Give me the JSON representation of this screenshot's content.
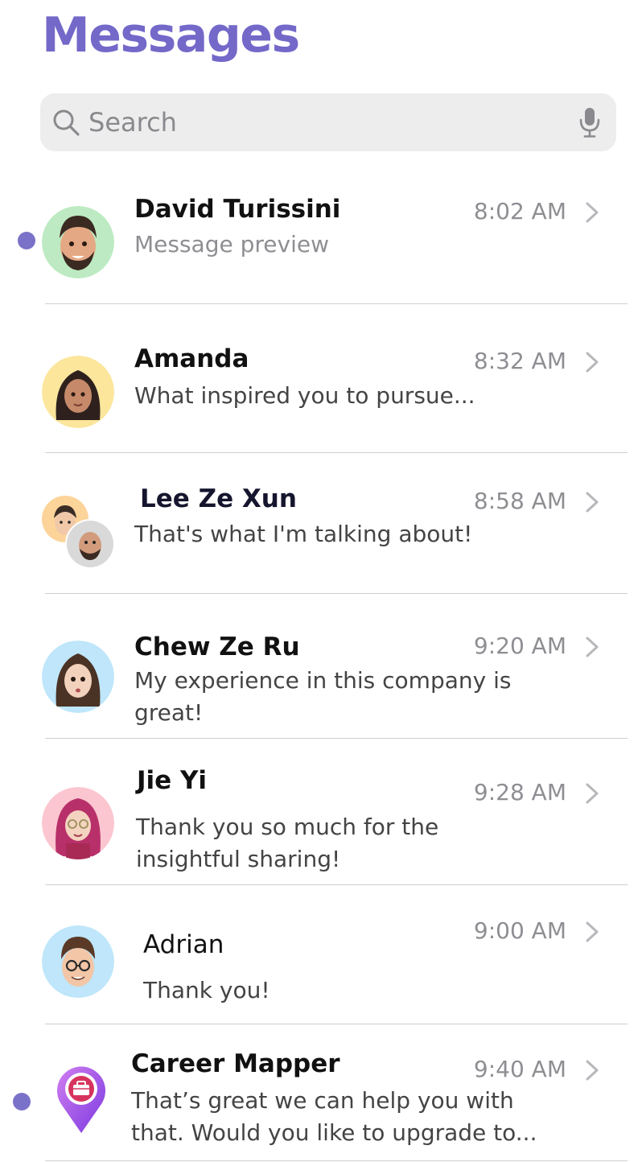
{
  "header": {
    "title": "Messages"
  },
  "search": {
    "placeholder": "Search",
    "search_icon": "magnifying-glass",
    "mic_icon": "microphone"
  },
  "accent_color": "#7468c9",
  "conversations": [
    {
      "name": "David Turissini",
      "preview": "Message preview",
      "time": "8:02 AM",
      "unread": true,
      "avatar": "memoji-man-beard-green"
    },
    {
      "name": "Amanda",
      "preview": "What inspired you to pursue...",
      "time": "8:32 AM",
      "unread": false,
      "avatar": "memoji-woman-yellow"
    },
    {
      "name": "Lee Ze Xun",
      "preview": "That's what I'm talking about!",
      "time": "8:58 AM",
      "unread": false,
      "avatar": "group-memoji"
    },
    {
      "name": "Chew Ze Ru",
      "preview": "My experience in this company is great!",
      "time": "9:20 AM",
      "unread": false,
      "avatar": "memoji-woman-blue"
    },
    {
      "name": "Jie Yi",
      "preview": "Thank you so much for the insightful sharing!",
      "time": "9:28 AM",
      "unread": false,
      "avatar": "memoji-woman-pink-hair"
    },
    {
      "name": "Adrian",
      "preview": "Thank you!",
      "time": "9:00 AM",
      "unread": false,
      "avatar": "memoji-man-glasses-blue"
    },
    {
      "name": "Career Mapper",
      "preview": "That’s great we can help you with that. Would you like to upgrade to...",
      "time": "9:40 AM",
      "unread": true,
      "avatar": "career-mapper-logo"
    }
  ]
}
